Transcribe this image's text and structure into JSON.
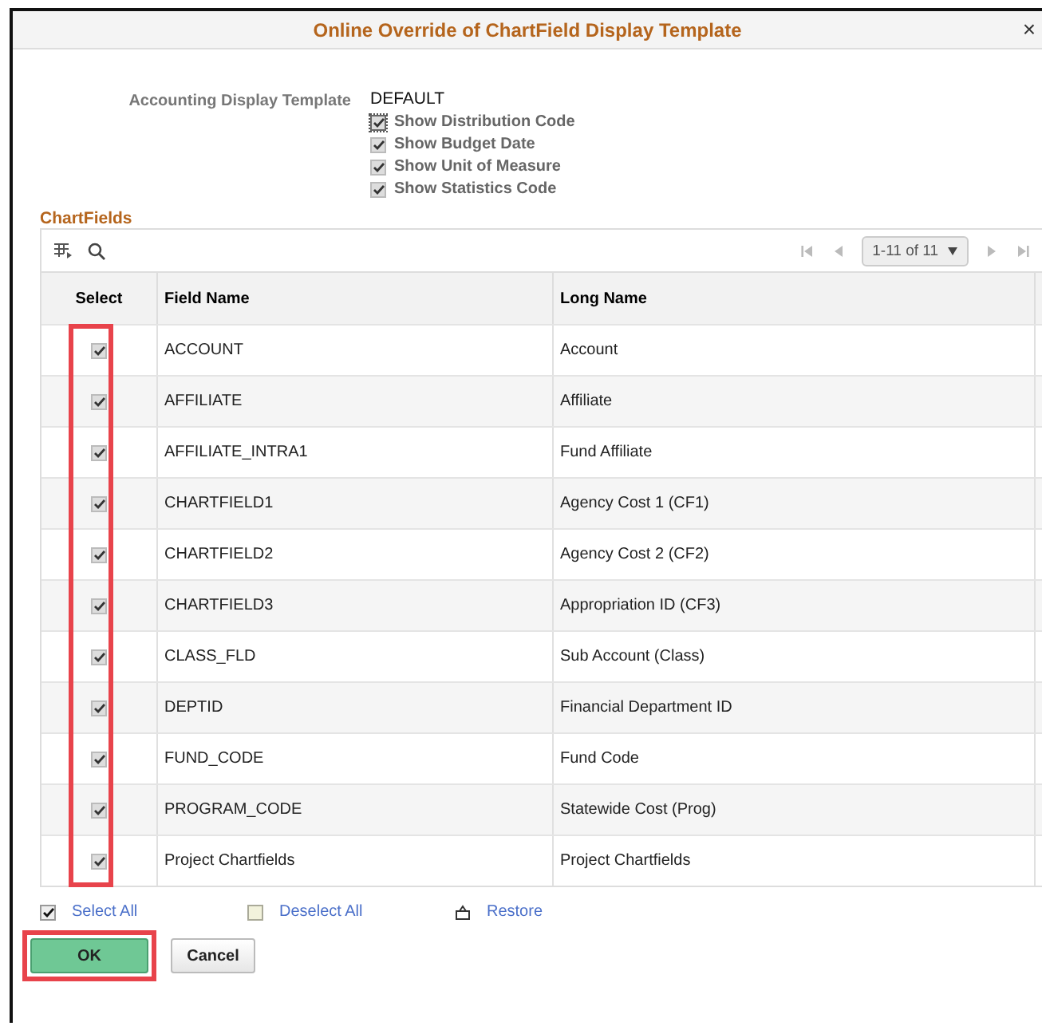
{
  "window": {
    "title": "Online Override of ChartField Display Template",
    "close": "×"
  },
  "template": {
    "label": "Accounting Display Template",
    "value": "DEFAULT"
  },
  "options": [
    {
      "label": "Show Distribution Code",
      "checked": true
    },
    {
      "label": "Show Budget Date",
      "checked": true
    },
    {
      "label": "Show Unit of Measure",
      "checked": true
    },
    {
      "label": "Show Statistics Code",
      "checked": true
    }
  ],
  "grid": {
    "title": "ChartFields",
    "pager": "1-11 of 11",
    "columns": [
      "Select",
      "Field Name",
      "Long Name"
    ],
    "select_highlighted": true,
    "rows": [
      {
        "checked": true,
        "field": "ACCOUNT",
        "long": "Account"
      },
      {
        "checked": true,
        "field": "AFFILIATE",
        "long": "Affiliate"
      },
      {
        "checked": true,
        "field": "AFFILIATE_INTRA1",
        "long": "Fund Affiliate"
      },
      {
        "checked": true,
        "field": "CHARTFIELD1",
        "long": "Agency Cost 1 (CF1)"
      },
      {
        "checked": true,
        "field": "CHARTFIELD2",
        "long": "Agency Cost 2 (CF2)"
      },
      {
        "checked": true,
        "field": "CHARTFIELD3",
        "long": "Appropriation ID (CF3)"
      },
      {
        "checked": true,
        "field": "CLASS_FLD",
        "long": "Sub Account (Class)"
      },
      {
        "checked": true,
        "field": "DEPTID",
        "long": "Financial Department ID"
      },
      {
        "checked": true,
        "field": "FUND_CODE",
        "long": "Fund Code"
      },
      {
        "checked": true,
        "field": "PROGRAM_CODE",
        "long": "Statewide Cost (Prog)"
      },
      {
        "checked": true,
        "field": "Project Chartfields",
        "long": "Project Chartfields"
      }
    ]
  },
  "links": [
    {
      "kind": "select",
      "label": "Select All"
    },
    {
      "kind": "deselect",
      "label": "Deselect All"
    },
    {
      "kind": "restore",
      "label": "Restore"
    }
  ],
  "buttons": [
    {
      "label": "OK",
      "primary": true,
      "highlighted": true
    },
    {
      "label": "Cancel",
      "primary": false,
      "highlighted": false
    }
  ]
}
